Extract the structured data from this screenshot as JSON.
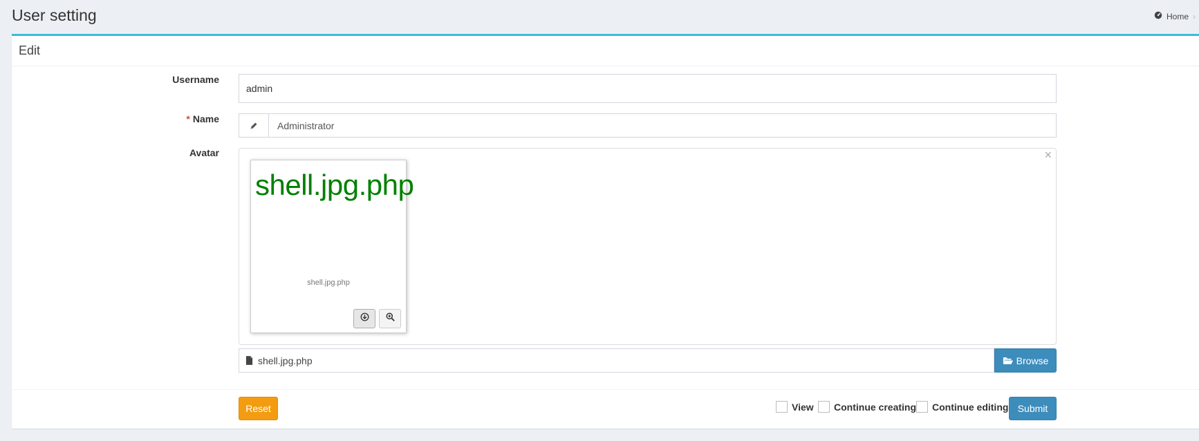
{
  "header": {
    "title": "User setting",
    "breadcrumb_home": "Home"
  },
  "box": {
    "title": "Edit"
  },
  "form": {
    "username_label": "Username",
    "username_value": "admin",
    "name_required": "*",
    "name_label": "Name",
    "name_value": "Administrator",
    "avatar_label": "Avatar",
    "avatar_preview_text": "shell.jpg.php",
    "avatar_caption": "shell.jpg.php",
    "file_name": "shell.jpg.php",
    "browse_label": "Browse"
  },
  "footer": {
    "reset_label": "Reset",
    "view_label": "View",
    "continue_creating_label": "Continue creating",
    "continue_editing_label": "Continue editing",
    "submit_label": "Submit"
  },
  "colors": {
    "accent": "#3cbbd8",
    "primary": "#3c8dbc",
    "warning": "#f39c12",
    "preview_text": "#008000"
  }
}
